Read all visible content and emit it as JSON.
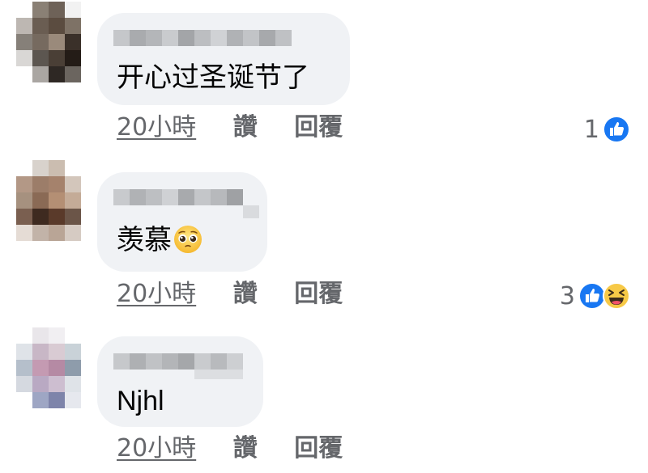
{
  "comments": [
    {
      "author": "",
      "text": "开心过圣诞节了",
      "time": "20小時",
      "like_label": "讚",
      "reply_label": "回覆",
      "reaction_count": "1",
      "reactions": [
        "like-icon"
      ]
    },
    {
      "author": "",
      "text": "羡慕",
      "emoji": "pleading-face-icon",
      "time": "20小時",
      "like_label": "讚",
      "reply_label": "回覆",
      "reaction_count": "3",
      "reactions": [
        "like-icon",
        "haha-icon"
      ]
    },
    {
      "author": "",
      "text": "Njhl",
      "time": "20小時",
      "like_label": "讚",
      "reply_label": "回覆"
    }
  ],
  "colors": {
    "bubble": "#f0f2f5",
    "meta_text": "#65676b",
    "like_blue": "#1877f2",
    "haha_yellow": "#f7c947"
  }
}
